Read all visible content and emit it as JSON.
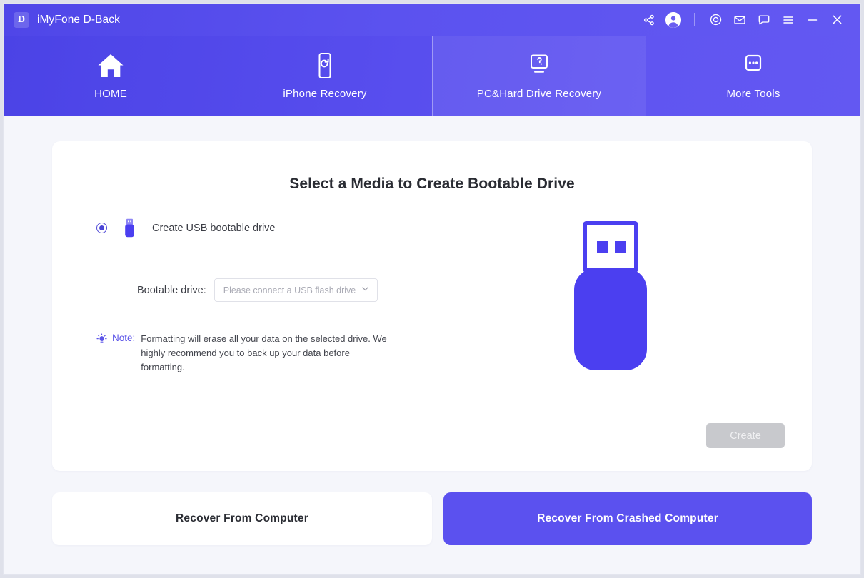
{
  "app": {
    "logo_letter": "D",
    "name": "iMyFone D-Back"
  },
  "titlebar_icons": [
    {
      "name": "share-icon",
      "label": "Share"
    },
    {
      "name": "account-icon",
      "label": "Account"
    },
    {
      "name": "target-icon",
      "label": "Register"
    },
    {
      "name": "mail-icon",
      "label": "Feedback"
    },
    {
      "name": "chat-icon",
      "label": "Support"
    },
    {
      "name": "menu-icon",
      "label": "Menu"
    },
    {
      "name": "minimize-icon",
      "label": "Minimize"
    },
    {
      "name": "close-icon",
      "label": "Close"
    }
  ],
  "nav": {
    "tabs": [
      {
        "label": "HOME",
        "icon": "home-icon",
        "active": false
      },
      {
        "label": "iPhone Recovery",
        "icon": "phone-refresh-icon",
        "active": false
      },
      {
        "label": "PC&Hard Drive Recovery",
        "icon": "monitor-recovery-icon",
        "active": true
      },
      {
        "label": "More Tools",
        "icon": "ellipsis-box-icon",
        "active": false
      }
    ]
  },
  "main": {
    "title": "Select a Media to Create Bootable Drive",
    "option": {
      "label": "Create USB bootable drive",
      "selected": true,
      "icon": "usb-drive-icon"
    },
    "drive_select": {
      "label": "Bootable drive:",
      "placeholder": "Please connect a USB flash drive",
      "value": "",
      "chevron": "chevron-down-icon"
    },
    "note": {
      "icon": "lightbulb-icon",
      "word": "Note:",
      "text": "Formatting will erase all your data on the selected drive. We highly recommend you to back up your data before formatting."
    },
    "illustration": "usb-drive-large-icon",
    "create_button": {
      "label": "Create",
      "enabled": false
    }
  },
  "bottom": {
    "secondary_label": "Recover From Computer",
    "primary_label": "Recover From Crashed Computer"
  },
  "colors": {
    "brand_purple": "#5b51ef",
    "header_gradient_start": "#4b43e6",
    "header_gradient_end": "#6358f2",
    "page_background": "#f5f6fb",
    "card_background": "#ffffff",
    "note_accent": "#5c55e8",
    "disabled_button": "#c8c9cd"
  }
}
